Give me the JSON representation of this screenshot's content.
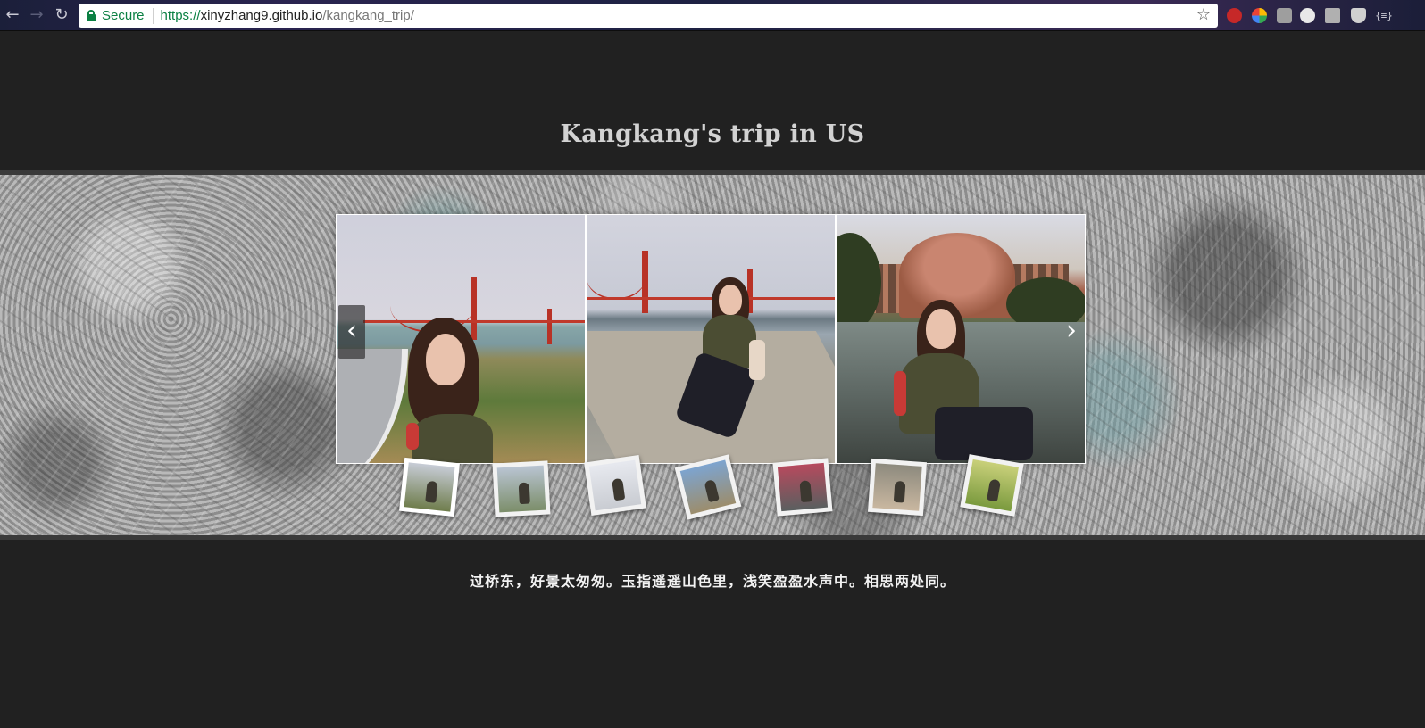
{
  "browser": {
    "back_glyph": "←",
    "forward_glyph": "→",
    "reload_glyph": "↻",
    "secure_label": "Secure",
    "url_scheme": "https://",
    "url_host": "xinyzhang9.github.io",
    "url_path": "/kangkang_trip/",
    "bookmark_glyph": "☆",
    "extension_badge": "{≡}"
  },
  "page": {
    "title": "Kangkang's trip in US",
    "caption": "过桥东，好景太匆匆。玉指遥遥山色里，浅笑盈盈水声中。相思两处同。"
  },
  "carousel": {
    "prev_glyph": "‹",
    "next_glyph": "›",
    "slides": [
      {
        "scene": "golden-gate-bridge-path"
      },
      {
        "scene": "golden-gate-bridge-seawall"
      },
      {
        "scene": "palace-of-fine-arts"
      }
    ],
    "thumbnails": [
      {
        "color_top": "#c7ccd6",
        "color_bottom": "#6f7d4c",
        "active": true
      },
      {
        "color_top": "#b9c4d2",
        "color_bottom": "#7c8e6a",
        "active": false
      },
      {
        "color_top": "#e7e9ef",
        "color_bottom": "#c9ccd2",
        "active": false
      },
      {
        "color_top": "#7da4cf",
        "color_bottom": "#9c8d6c",
        "active": false
      },
      {
        "color_top": "#b64a5e",
        "color_bottom": "#5a5f5f",
        "active": false
      },
      {
        "color_top": "#8d8a7e",
        "color_bottom": "#c9b7a0",
        "active": false
      },
      {
        "color_top": "#c9d07a",
        "color_bottom": "#7a9a3e",
        "active": false
      }
    ]
  }
}
